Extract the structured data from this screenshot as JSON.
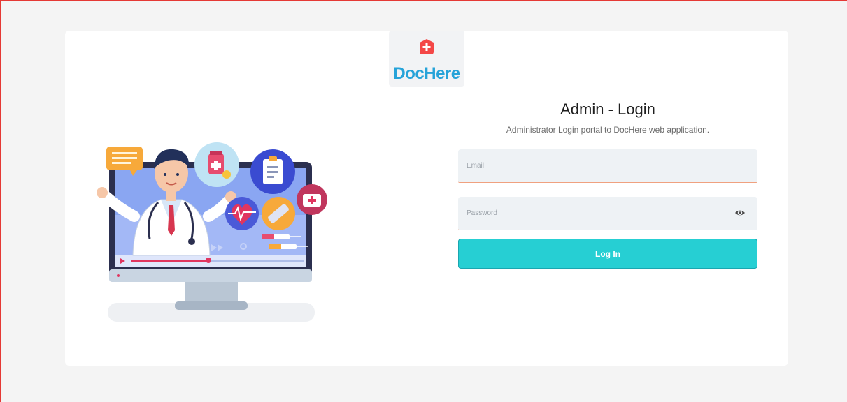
{
  "brand": {
    "name": "DocHere",
    "color": "#26a3d9",
    "icon_color": "#f44747"
  },
  "login": {
    "title": "Admin - Login",
    "subtitle": "Administrator Login portal to DocHere web application.",
    "email_placeholder": "Email",
    "password_placeholder": "Password",
    "button_label": "Log In",
    "button_color": "#26cfd3"
  },
  "icons": {
    "logo": "medical-plus-icon",
    "password_toggle": "eye-icon",
    "illustration": "doctor-monitor-illustration"
  }
}
